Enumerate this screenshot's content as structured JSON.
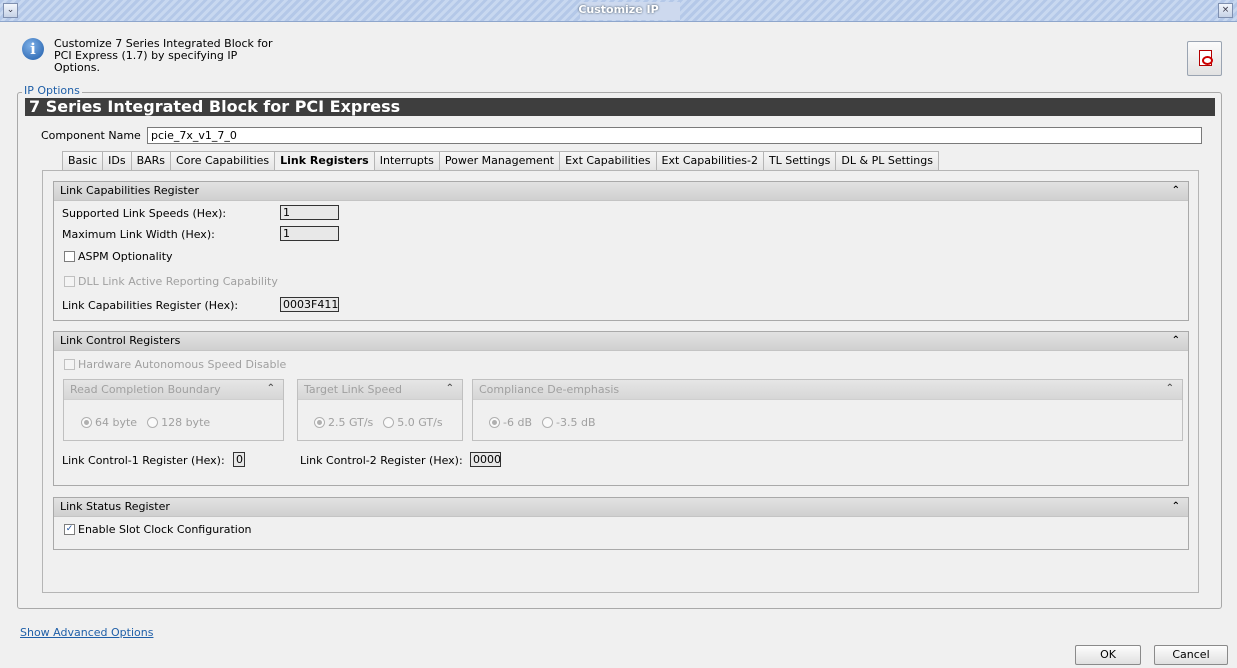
{
  "window": {
    "title": "Customize IP",
    "menu_icon": "chevron-down-icon",
    "close_icon": "close-icon"
  },
  "header": {
    "description": "Customize 7 Series Integrated Block for PCI Express (1.7) by specifying IP Options.",
    "pdf_icon": "pdf-icon"
  },
  "ip_options": {
    "legend": "IP Options",
    "banner": "7 Series Integrated Block for PCI Express",
    "component_name_label": "Component Name",
    "component_name_value": "pcie_7x_v1_7_0"
  },
  "tabs": [
    {
      "label": "Basic",
      "active": false
    },
    {
      "label": "IDs",
      "active": false
    },
    {
      "label": "BARs",
      "active": false
    },
    {
      "label": "Core Capabilities",
      "active": false
    },
    {
      "label": "Link Registers",
      "active": true
    },
    {
      "label": "Interrupts",
      "active": false
    },
    {
      "label": "Power Management",
      "active": false
    },
    {
      "label": "Ext Capabilities",
      "active": false
    },
    {
      "label": "Ext Capabilities-2",
      "active": false
    },
    {
      "label": "TL Settings",
      "active": false
    },
    {
      "label": "DL & PL Settings",
      "active": false
    }
  ],
  "link_capabilities": {
    "title": "Link Capabilities Register",
    "speeds_label": "Supported Link Speeds (Hex):",
    "speeds_value": "1",
    "width_label": "Maximum Link Width (Hex):",
    "width_value": "1",
    "aspm_label": "ASPM Optionality",
    "aspm_checked": false,
    "dll_label": "DLL Link Active Reporting Capability",
    "dll_checked": false,
    "reg_label": "Link Capabilities Register (Hex):",
    "reg_value": "0003F411"
  },
  "link_control": {
    "title": "Link Control Registers",
    "hw_label": "Hardware Autonomous Speed Disable",
    "rcb": {
      "title": "Read Completion Boundary",
      "options": [
        "64 byte",
        "128 byte"
      ],
      "selected": "64 byte"
    },
    "tls": {
      "title": "Target Link Speed",
      "options": [
        "2.5 GT/s",
        "5.0 GT/s"
      ],
      "selected": "2.5 GT/s"
    },
    "cde": {
      "title": "Compliance De-emphasis",
      "options": [
        "-6 dB",
        "-3.5 dB"
      ],
      "selected": "-6 dB"
    },
    "ctrl1_label": "Link Control-1 Register (Hex):",
    "ctrl1_value": "0",
    "ctrl2_label": "Link Control-2 Register (Hex):",
    "ctrl2_value": "0000"
  },
  "link_status": {
    "title": "Link Status Register",
    "slot_clock_label": "Enable Slot Clock Configuration",
    "slot_clock_checked": true
  },
  "footer": {
    "advanced_link": "Show Advanced Options",
    "ok_label": "OK",
    "cancel_label": "Cancel"
  }
}
